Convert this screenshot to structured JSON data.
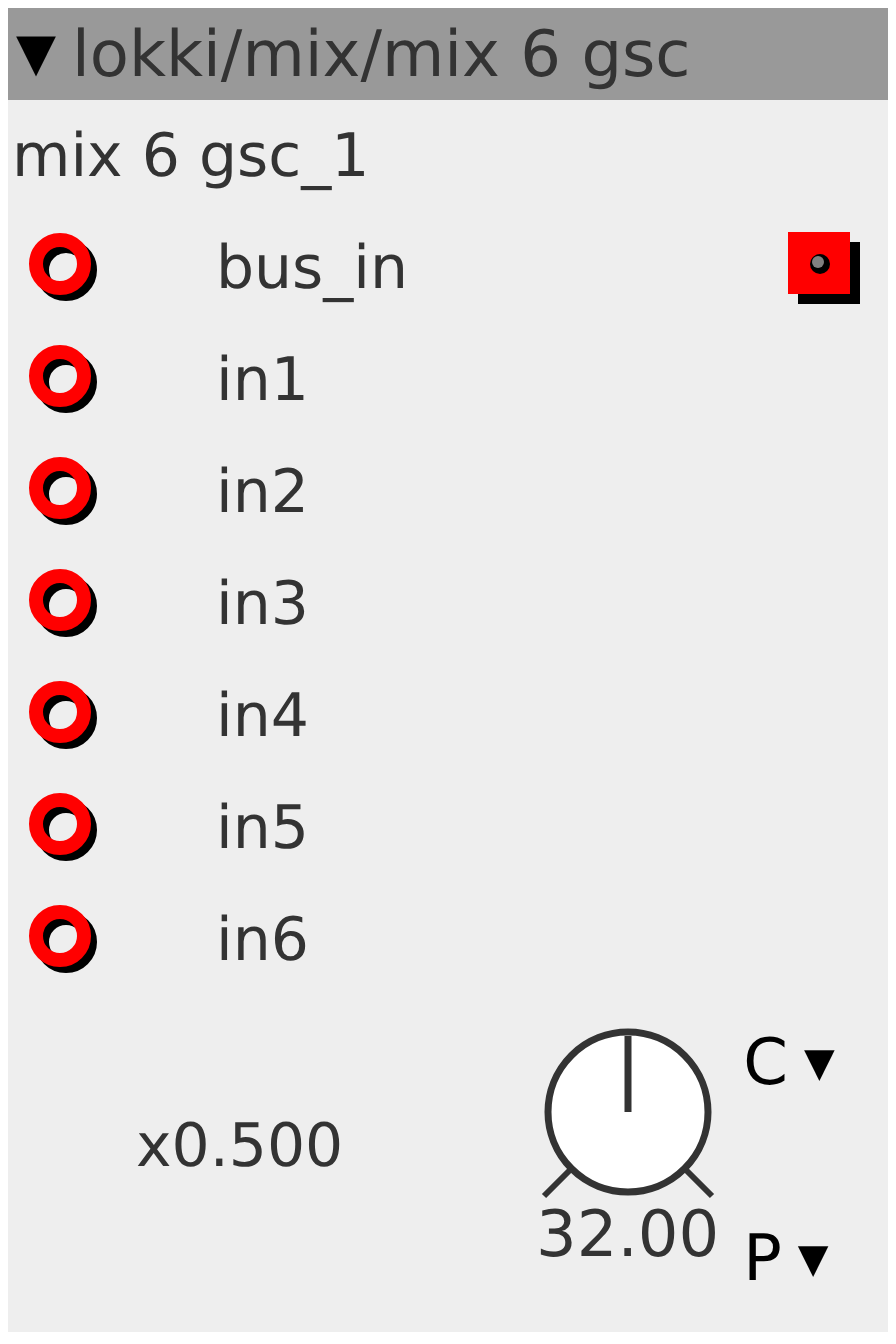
{
  "header": {
    "toggle": "▼",
    "title": "lokki/mix/mix 6 gsc"
  },
  "instance_name": "mix 6 gsc_1",
  "ports": [
    {
      "label": "bus_in",
      "outlet": true
    },
    {
      "label": "in1",
      "outlet": false
    },
    {
      "label": "in2",
      "outlet": false
    },
    {
      "label": "in3",
      "outlet": false
    },
    {
      "label": "in4",
      "outlet": false
    },
    {
      "label": "in5",
      "outlet": false
    },
    {
      "label": "in6",
      "outlet": false
    }
  ],
  "parameter": {
    "scale": "x0.500",
    "value": "32.00",
    "menus": [
      {
        "label": "C",
        "arrow": "▼"
      },
      {
        "label": "P",
        "arrow": "▼"
      }
    ]
  }
}
